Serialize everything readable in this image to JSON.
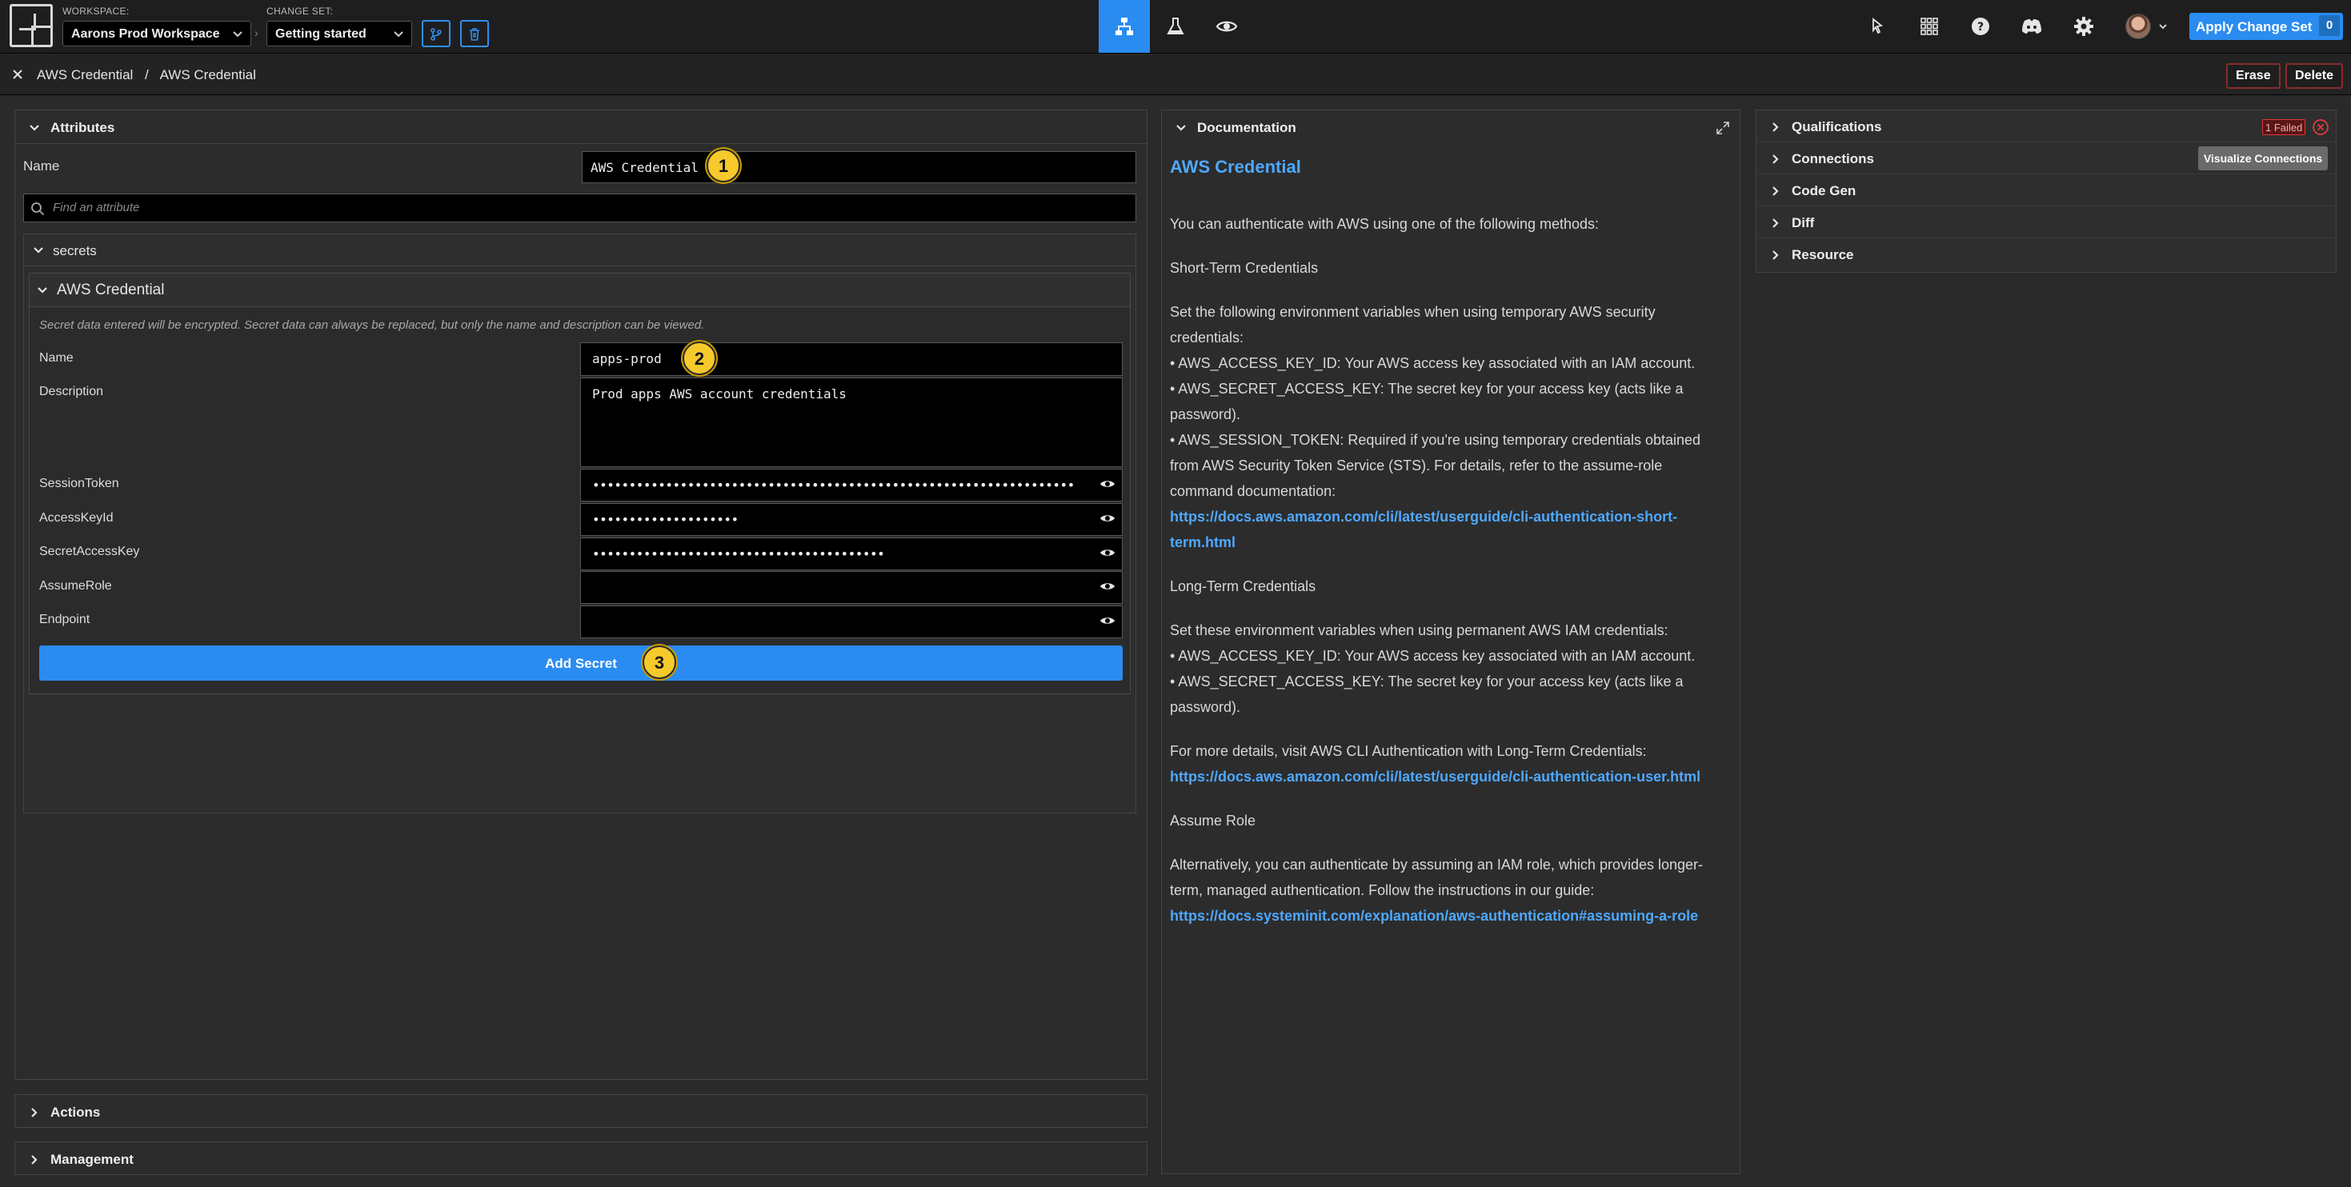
{
  "topbar": {
    "workspace_label": "WORKSPACE:",
    "workspace_value": "Aarons Prod Workspace",
    "changeset_label": "CHANGE SET:",
    "changeset_value": "Getting started",
    "nav_icons": [
      "diagram-icon",
      "flask-icon",
      "eye-icon"
    ],
    "right_icons": [
      "cursor-icon",
      "grid-icon",
      "help-icon",
      "discord-icon",
      "gear-icon"
    ],
    "apply_label": "Apply Change Set",
    "apply_count": "0"
  },
  "breadcrumb": {
    "parent": "AWS Credential",
    "separator": "/",
    "current": "AWS Credential",
    "erase_label": "Erase",
    "delete_label": "Delete"
  },
  "attributes": {
    "title": "Attributes",
    "name_label": "Name",
    "name_value": "AWS Credential",
    "search_placeholder": "Find an attribute",
    "secrets_label": "secrets",
    "secret_section_title": "AWS Credential",
    "secret_note": "Secret data entered will be encrypted. Secret data can always be replaced, but only the name and description can be viewed.",
    "secret_name_label": "Name",
    "secret_name_value": "apps-prod",
    "description_label": "Description",
    "description_value": "Prod apps AWS account credentials",
    "fields": [
      {
        "label": "SessionToken",
        "value": "••••••••••••••••••••••••••••••••••••••••••••••••••••••••••••••••••"
      },
      {
        "label": "AccessKeyId",
        "value": "••••••••••••••••••••"
      },
      {
        "label": "SecretAccessKey",
        "value": "••••••••••••••••••••••••••••••••••••••••"
      },
      {
        "label": "AssumeRole",
        "value": ""
      },
      {
        "label": "Endpoint",
        "value": ""
      }
    ],
    "add_secret_label": "Add Secret",
    "badges": [
      "1",
      "2",
      "3"
    ]
  },
  "bottom_sections": {
    "actions": "Actions",
    "management": "Management"
  },
  "documentation": {
    "title": "Documentation",
    "heading": "AWS Credential",
    "intro": "You can authenticate with AWS using one of the following methods:",
    "short_term_title": "Short-Term Credentials",
    "short_term_intro": "Set the following environment variables when using temporary AWS security credentials:",
    "short_term_items": [
      "• AWS_ACCESS_KEY_ID: Your AWS access key associated with an IAM account.",
      "• AWS_SECRET_ACCESS_KEY: The secret key for your access key (acts like a password).",
      "• AWS_SESSION_TOKEN: Required if you're using temporary credentials obtained from AWS Security Token Service (STS). For details, refer to the assume-role command documentation:"
    ],
    "short_term_link": "https://docs.aws.amazon.com/cli/latest/userguide/cli-authentication-short-term.html",
    "long_term_title": "Long-Term Credentials",
    "long_term_intro": "Set these environment variables when using permanent AWS IAM credentials:",
    "long_term_items": [
      "• AWS_ACCESS_KEY_ID: Your AWS access key associated with an IAM account.",
      "• AWS_SECRET_ACCESS_KEY: The secret key for your access key (acts like a password)."
    ],
    "more_details": "For more details, visit AWS CLI Authentication with Long-Term Credentials:",
    "long_term_link": "https://docs.aws.amazon.com/cli/latest/userguide/cli-authentication-user.html",
    "assume_title": "Assume Role",
    "assume_text": "Alternatively, you can authenticate by assuming an IAM role, which provides longer-term, managed authentication. Follow the instructions in our guide:",
    "assume_link": "https://docs.systeminit.com/explanation/aws-authentication#assuming-a-role"
  },
  "right_panel": {
    "qualifications": "Qualifications",
    "qual_badge": "1 Failed",
    "connections": "Connections",
    "visualize_label": "Visualize Connections",
    "codegen": "Code Gen",
    "diff": "Diff",
    "resource": "Resource"
  },
  "colors": {
    "accent": "#2a8cf0",
    "link": "#4ea8ff",
    "danger": "#e03a3a",
    "badge": "#f6c92c"
  }
}
